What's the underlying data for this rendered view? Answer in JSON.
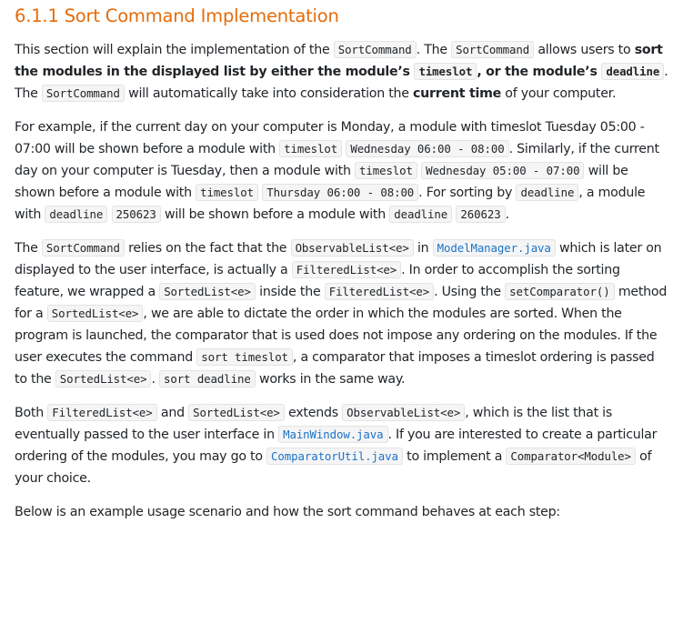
{
  "heading": "6.1.1 Sort Command Implementation",
  "p1": {
    "t1": "This section will explain the implementation of the ",
    "c1": "SortCommand",
    "t2": ". The ",
    "c2": "SortCommand",
    "t3": " allows users to ",
    "b1": "sort the modules in the displayed list by either the module’s ",
    "c3": "timeslot",
    "b2": ", or the module’s ",
    "c4": "deadline",
    "t4": ". The ",
    "c5": "SortCommand",
    "t5": " will automatically take into consideration the ",
    "b3": "current time",
    "t6": " of your computer."
  },
  "p2": {
    "t1": "For example, if the current day on your computer is Monday, a module with timeslot Tuesday 05:00 - 07:00 will be shown before a module with ",
    "c1": "timeslot",
    "t2": " ",
    "c2": "Wednesday 06:00 - 08:00",
    "t3": ". Similarly, if the current day on your computer is Tuesday, then a module with ",
    "c3": "timeslot",
    "t4": " ",
    "c4": "Wednesday 05:00 - 07:00",
    "t5": " will be shown before a module with ",
    "c5": "timeslot",
    "t6": " ",
    "c6": "Thursday 06:00 - 08:00",
    "t7": ". For sorting by ",
    "c7": "deadline",
    "t8": ", a module with ",
    "c8": "deadline",
    "t9": " ",
    "c9": "250623",
    "t10": " will be shown before a module with ",
    "c10": "deadline",
    "t11": " ",
    "c11": "260623",
    "t12": "."
  },
  "p3": {
    "t1": "The ",
    "c1": "SortCommand",
    "t2": " relies on the fact that the ",
    "c2": "ObservableList<e>",
    "t3": " in ",
    "l1": "ModelManager.java",
    "t4": " which is later on displayed to the user interface, is actually a ",
    "c3": "FilteredList<e>",
    "t5": ". In order to accomplish the sorting feature, we wrapped a ",
    "c4": "SortedList<e>",
    "t6": " inside the ",
    "c5": "FilteredList<e>",
    "t7": ". Using the ",
    "c6": "setComparator()",
    "t8": " method for a ",
    "c7": "SortedList<e>",
    "t9": ", we are able to dictate the order in which the modules are sorted. When the program is launched, the comparator that is used does not impose any ordering on the modules. If the user executes the command ",
    "c8": "sort timeslot",
    "t10": ", a comparator that imposes a timeslot ordering is passed to the ",
    "c9": "SortedList<e>",
    "t11": ". ",
    "c10": "sort deadline",
    "t12": " works in the same way."
  },
  "p4": {
    "t1": "Both ",
    "c1": "FilteredList<e>",
    "t2": " and ",
    "c2": "SortedList<e>",
    "t3": " extends ",
    "c3": "ObservableList<e>",
    "t4": ", which is the list that is eventually passed to the user interface in ",
    "l1": "MainWindow.java",
    "t5": ". If you are interested to create a particular ordering of the modules, you may go to ",
    "l2": "ComparatorUtil.java",
    "t6": " to implement a ",
    "c4": "Comparator<Module>",
    "t7": " of your choice."
  },
  "p5": "Below is an example usage scenario and how the sort command behaves at each step:"
}
